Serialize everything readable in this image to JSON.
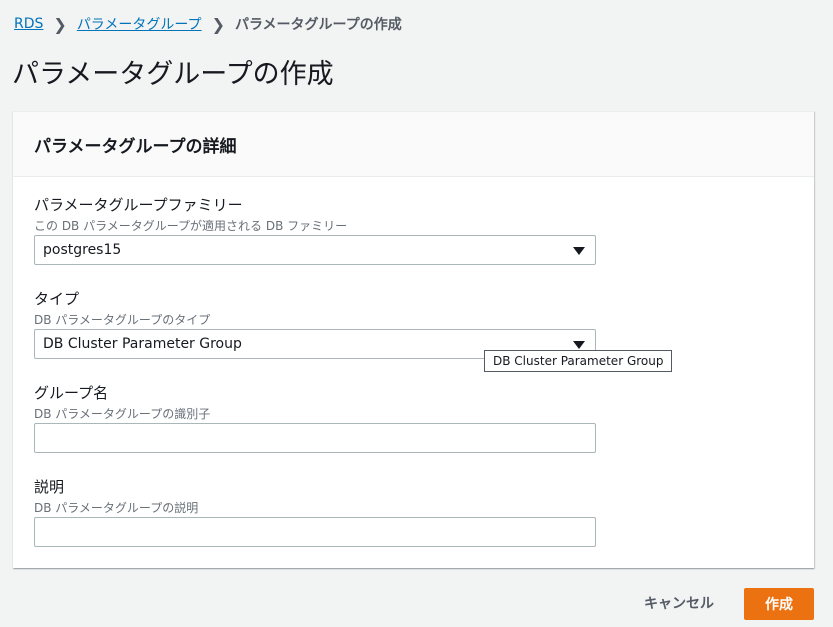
{
  "breadcrumb": {
    "items": [
      "RDS",
      "パラメータグループ",
      "パラメータグループの作成"
    ]
  },
  "page_title": "パラメータグループの作成",
  "panel": {
    "title": "パラメータグループの詳細",
    "fields": {
      "family": {
        "label": "パラメータグループファミリー",
        "description": "この DB パラメータグループが適用される DB ファミリー",
        "value": "postgres15"
      },
      "type": {
        "label": "タイプ",
        "description": "DB パラメータグループのタイプ",
        "value": "DB Cluster Parameter Group",
        "tooltip": "DB Cluster Parameter Group"
      },
      "group_name": {
        "label": "グループ名",
        "description": "DB パラメータグループの識別子",
        "value": ""
      },
      "description": {
        "label": "説明",
        "description": "DB パラメータグループの説明",
        "value": ""
      }
    }
  },
  "actions": {
    "cancel_label": "キャンセル",
    "create_label": "作成"
  },
  "colors": {
    "link": "#0073bb",
    "primary_button": "#ec7211",
    "background": "#f2f3f3"
  }
}
